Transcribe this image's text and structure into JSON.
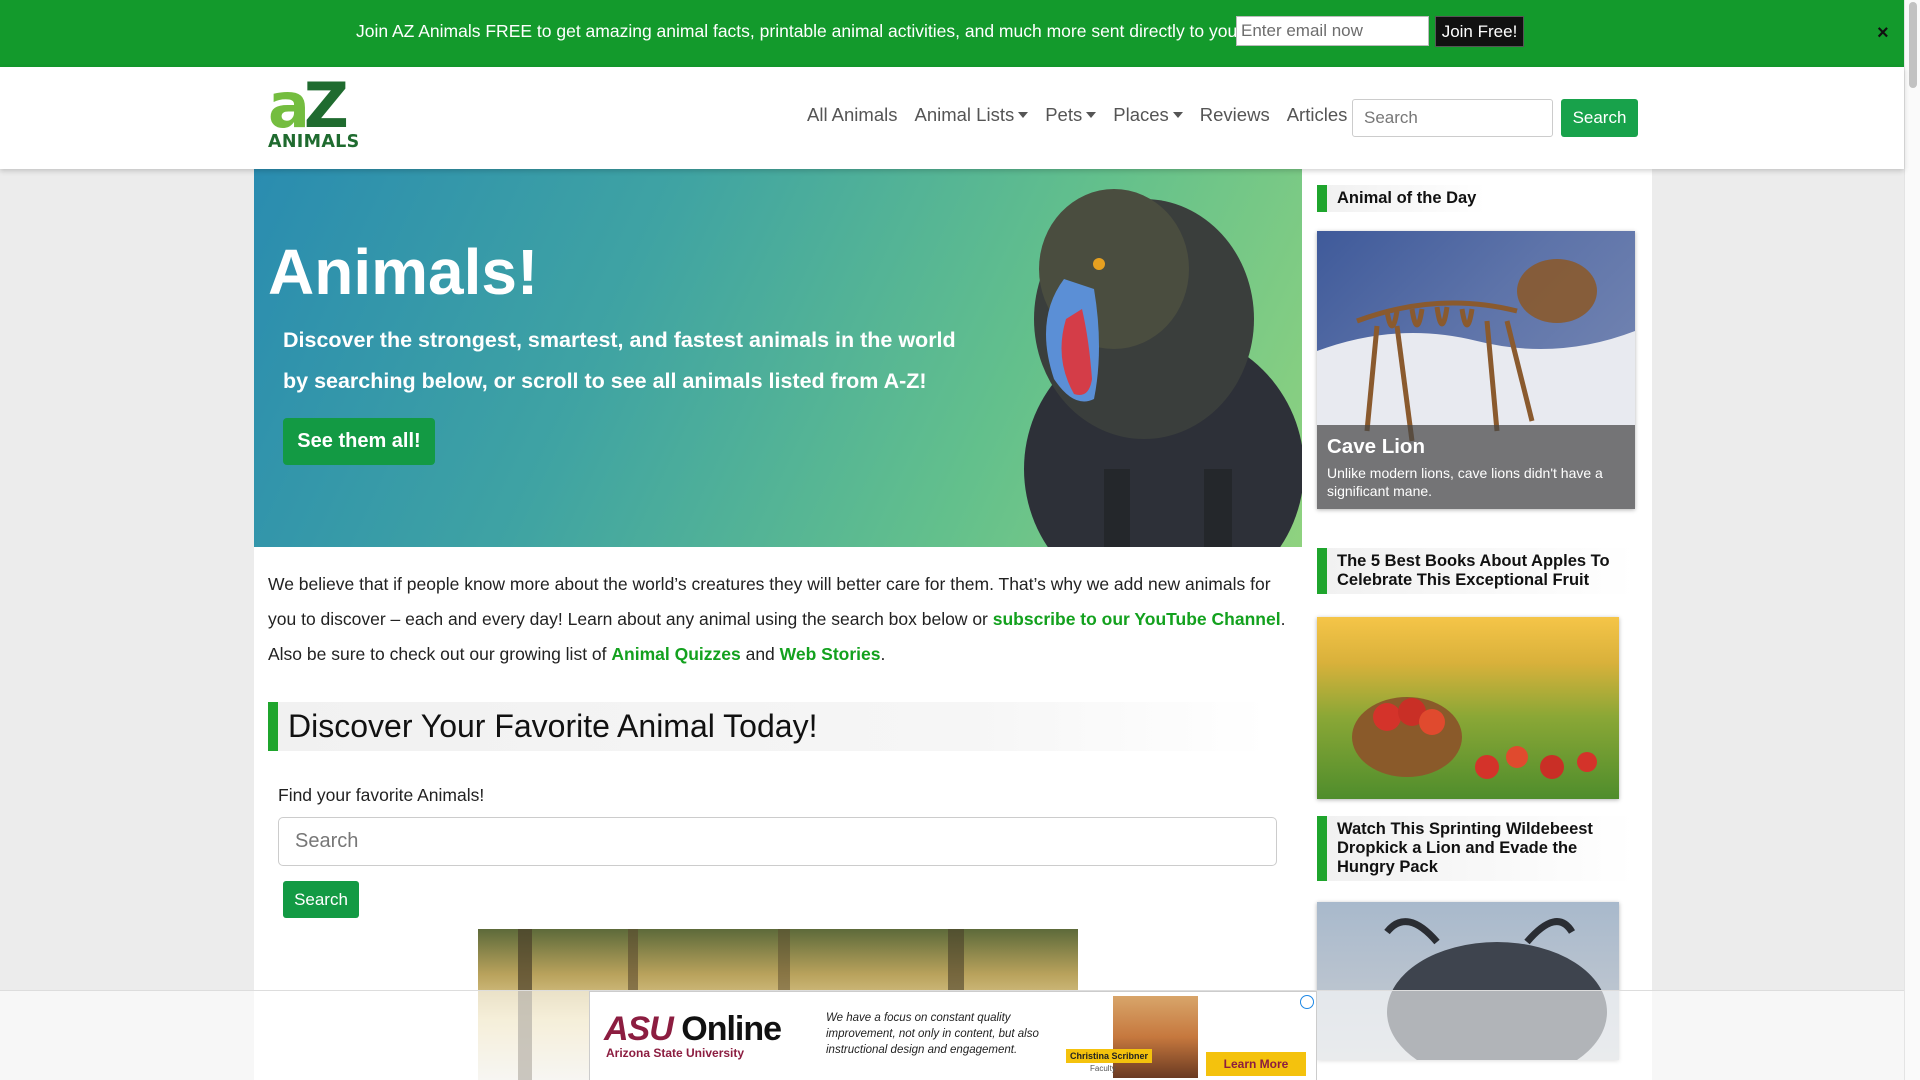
{
  "promo": {
    "text": "Join AZ Animals FREE to get amazing animal facts, printable animal activities, and much more sent directly to you",
    "email_placeholder": "Enter email now",
    "join_label": "Join Free!",
    "close_label": "×"
  },
  "header": {
    "logo_top_a": "a",
    "logo_top_z": "Z",
    "logo_bottom": "ANIMALS",
    "nav": [
      {
        "label": "All Animals",
        "dropdown": false
      },
      {
        "label": "Animal Lists",
        "dropdown": true
      },
      {
        "label": "Pets",
        "dropdown": true
      },
      {
        "label": "Places",
        "dropdown": true
      },
      {
        "label": "Reviews",
        "dropdown": false
      },
      {
        "label": "Articles",
        "dropdown": false
      }
    ],
    "search_placeholder": "Search",
    "search_button": "Search"
  },
  "hero": {
    "title": "Animals!",
    "subtitle": "Discover the strongest, smartest, and fastest animals in the world by searching below, or scroll to see all animals listed from A-Z!",
    "button": "See them all!"
  },
  "intro": {
    "part1": "We believe that if people know more about the world’s creatures they will better care for them. That’s why we add new animals for you to discover – each and every day! Learn about any animal using the search box below or ",
    "link_youtube": "subscribe to our YouTube Channel",
    "part2": ". Also be sure to check out our growing list of ",
    "link_quizzes": "Animal Quizzes",
    "part3": " and ",
    "link_stories": "Web Stories",
    "part4": "."
  },
  "discover": {
    "heading": "Discover Your Favorite Animal Today!",
    "find_label": "Find your favorite Animals!",
    "search_placeholder": "Search",
    "search_button": "Search"
  },
  "sidebar": {
    "aotd_heading": "Animal of the Day",
    "aotd_name": "Cave Lion",
    "aotd_desc": "Unlike modern lions, cave lions didn't have a significant mane.",
    "article1": "The 5 Best Books About Apples To Celebrate This Exceptional Fruit",
    "article2": "Watch This Sprinting Wildebeest Dropkick a Lion and Evade the Hungry Pack"
  },
  "ad": {
    "brand_asu": "ASU",
    "brand_online": " Online",
    "brand_sub": "Arizona State University",
    "quote": "We have a focus on constant quality improvement, not only in content, but also instructional design and engagement.",
    "person_name": "Christina Scribner",
    "person_role": "Faculty",
    "cta": "Learn More"
  },
  "colors": {
    "brand_green": "#139a2c",
    "link_green": "#13a11e",
    "button_green": "#139a44"
  }
}
